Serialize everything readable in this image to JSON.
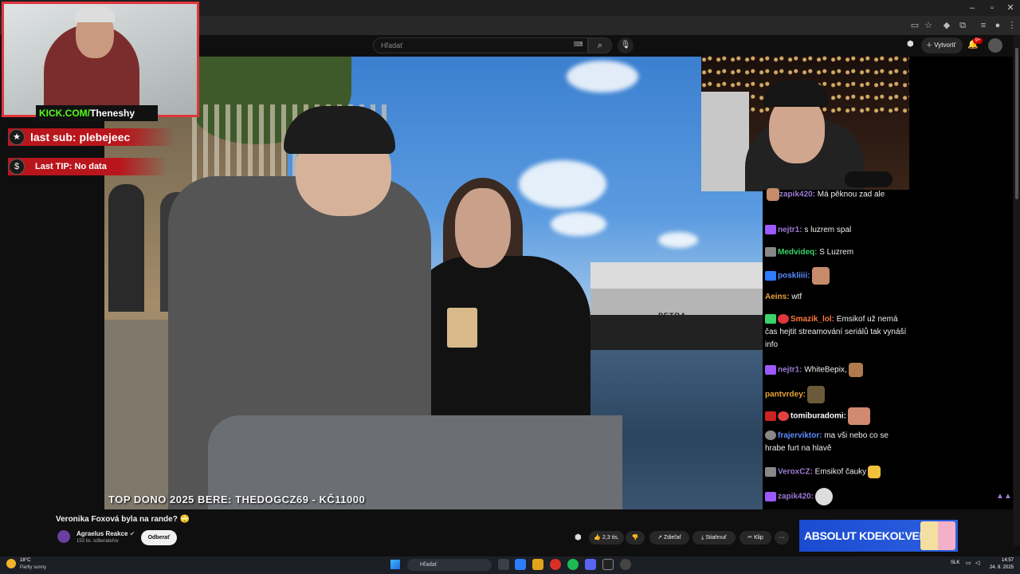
{
  "youtube": {
    "search_placeholder": "Hľadať",
    "create_label": "Vytvoriť",
    "notification_count": "9+"
  },
  "overlay": {
    "kick_prefix": "KICK.COM/",
    "kick_channel": "Theneshy",
    "last_sub": "last sub: plebejeec",
    "last_tip": "Last TIP: No data",
    "top_dono": "TOP DONO 2025 BERE: THEDOGCZ69 - KČ11000",
    "boat_name": "PETRA"
  },
  "chat": {
    "messages": [
      {
        "user": "zapik420:",
        "text": " Má pěknou zad ale",
        "color": "#9b7bd4"
      },
      {
        "user": "nejtr1:",
        "text": " s luzrem spal",
        "color": "#9b7bd4"
      },
      {
        "user": "Medvideq:",
        "text": " S Luzrem",
        "color": "#3ad26a"
      },
      {
        "user": "poskliiii:",
        "text": "",
        "color": "#5b8cff"
      },
      {
        "user": "Aeins:",
        "text": " wtf",
        "color": "#e8a33a"
      },
      {
        "user": "Smazik_lol:",
        "text": " Emsikof už nemá čas hejtit streamování seriálů tak vynáší info",
        "color": "#ff7a3d"
      },
      {
        "user": "nejtr1:",
        "text": " WhiteBepix,",
        "color": "#9b7bd4"
      },
      {
        "user": "pantvrdey:",
        "text": "",
        "color": "#e8a33a"
      },
      {
        "user": "tomiburadomi:",
        "text": "",
        "color": "#ffffff"
      },
      {
        "user": "frajerviktor:",
        "text": " ma vši nebo co se hrabe furt na hlavě",
        "color": "#5b8cff"
      },
      {
        "user": "VeroxCZ:",
        "text": " Emsikof čauky",
        "color": "#9b7bd4"
      },
      {
        "user": "zapik420:",
        "text": "",
        "color": "#9b7bd4"
      }
    ]
  },
  "video": {
    "title": "Veronika Foxová byla na rande? 🙄",
    "channel_name": "Agraelus Reakce",
    "channel_subs": "153 tis. odberateľov",
    "subscribe_label": "Odberať",
    "likes": "2,3 tis.",
    "share_label": "Zdieľať",
    "download_label": "Stiahnuť",
    "clip_label": "Klip",
    "more_label": "···"
  },
  "ad": {
    "text": "ABSOLUT KDEKOĽVEK"
  },
  "taskbar": {
    "weather_temp": "18°C",
    "weather_desc": "Partly sunny",
    "search_placeholder": "Hľadať",
    "language": "SLK",
    "time": "14:57",
    "date": "24. 8. 2025"
  },
  "colors": {
    "kick_green": "#53fc18",
    "overlay_red": "#b8161c",
    "youtube_bg": "#0f0f0f"
  }
}
